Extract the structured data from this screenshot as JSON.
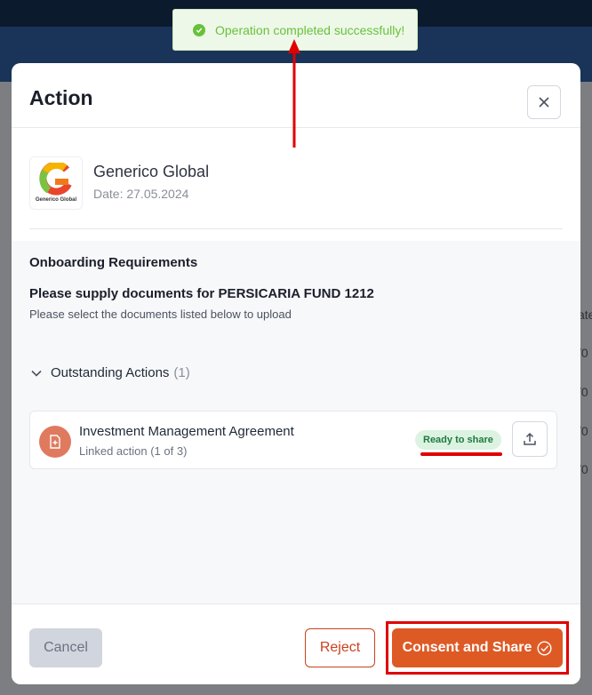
{
  "background": {
    "column_header": "ate",
    "column_cells": [
      "/0",
      "/0",
      "/0",
      "/0"
    ]
  },
  "toast": {
    "message": "Operation completed successfully!",
    "icon": "check-circle-icon",
    "color": "#67c23a"
  },
  "modal": {
    "title": "Action",
    "close_icon": "close-icon",
    "company": {
      "name": "Generico Global",
      "date": "Date: 27.05.2024",
      "logo_text": "Generico Global"
    },
    "requirements": {
      "heading": "Onboarding Requirements",
      "subheading": "Please supply documents for PERSICARIA FUND 1212",
      "instruction": "Please select the documents listed below to upload"
    },
    "outstanding": {
      "label": "Outstanding Actions",
      "count": "(1)",
      "items": [
        {
          "name": "Investment Management Agreement",
          "sub": "Linked action (1 of 3)",
          "status": "Ready to share",
          "icon": "document-add-icon",
          "action_icon": "upload-icon"
        }
      ]
    },
    "footer": {
      "cancel": "Cancel",
      "reject": "Reject",
      "consent": "Consent and Share"
    }
  },
  "colors": {
    "accent": "#de5a25",
    "annotation": "#e00000",
    "success": "#1f7a3f"
  }
}
